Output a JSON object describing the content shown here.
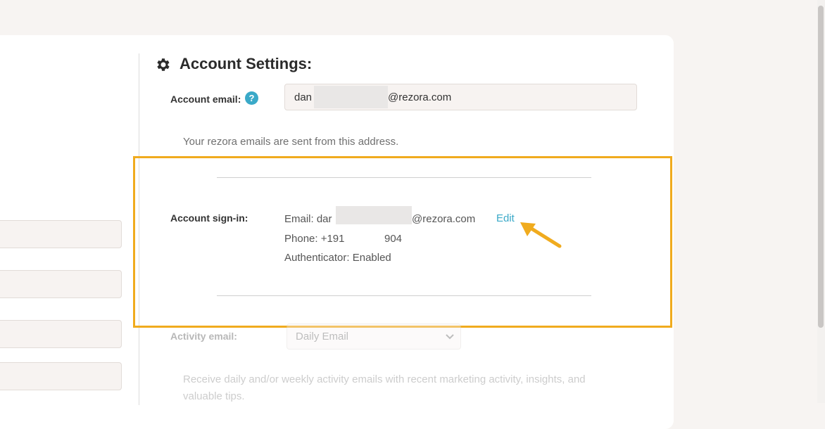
{
  "settings": {
    "title": "Account Settings:",
    "account_email": {
      "label": "Account email:",
      "help_icon": "?",
      "value_prefix": "dan",
      "value_suffix": "@rezora.com",
      "help_text": "Your rezora emails are sent from this address."
    },
    "signin": {
      "label": "Account sign-in:",
      "email_prefix": "Email: dar",
      "email_suffix": "@rezora.com",
      "phone_prefix": "Phone: +191",
      "phone_suffix": "904",
      "authenticator": "Authenticator: Enabled",
      "edit_label": "Edit"
    },
    "activity_email": {
      "label": "Activity email:",
      "selected": "Daily Email",
      "help_text_line1": "Receive daily and/or weekly activity emails with recent marketing activity, insights, and",
      "help_text_line2": "valuable tips."
    }
  },
  "icons": {
    "settings": "gear-icon",
    "help": "question-icon",
    "select": "chevron-down-icon",
    "annotation": "arrow-icon"
  },
  "colors": {
    "accent": "#3aa9c8",
    "highlight": "#f0ab1e"
  }
}
